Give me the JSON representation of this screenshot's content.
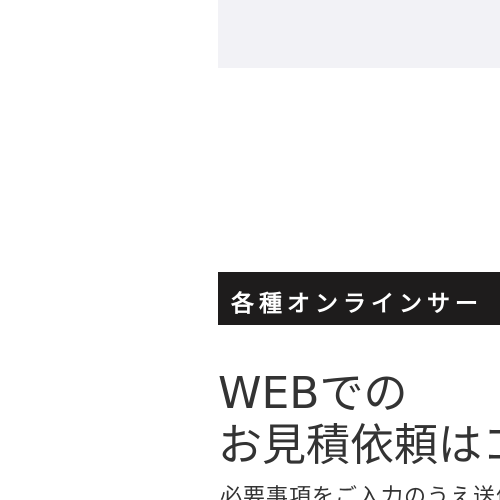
{
  "section": {
    "label": "各種オンラインサー"
  },
  "heading": {
    "line1": "WEBでの",
    "line2": "お見積依頼はコ"
  },
  "description": {
    "text": "必要事項をご入力のうえ送信"
  },
  "colors": {
    "panel_bg": "#f2f2f6",
    "label_bg": "#1e1c1c",
    "label_text": "#ffffff",
    "heading_text": "#333333"
  }
}
